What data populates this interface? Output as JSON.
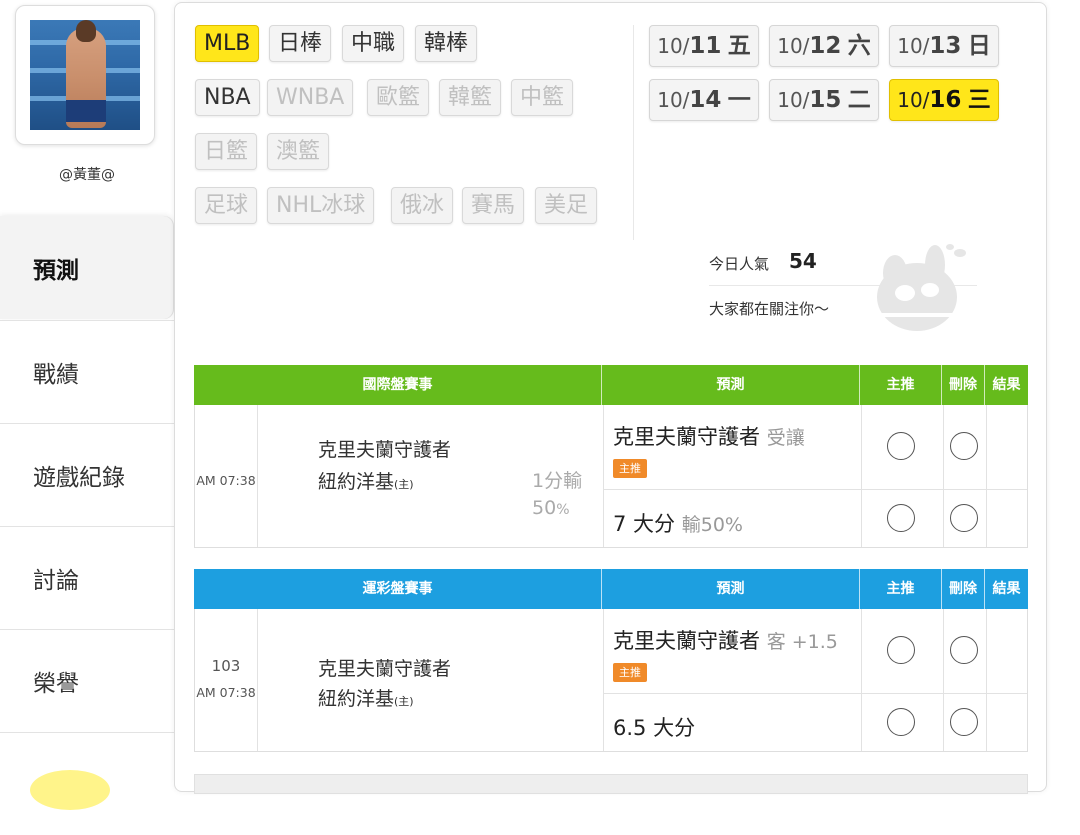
{
  "sidebar": {
    "username": "@黃董@",
    "nav": [
      "預測",
      "戰績",
      "遊戲紀錄",
      "討論",
      "榮譽"
    ]
  },
  "categories": {
    "row1": [
      {
        "label": "MLB",
        "state": "active"
      },
      {
        "label": "日棒",
        "state": "normal"
      },
      {
        "label": "中職",
        "state": "normal"
      },
      {
        "label": "韓棒",
        "state": "normal"
      }
    ],
    "row2": [
      {
        "label": "NBA",
        "state": "normal"
      },
      {
        "label": "WNBA",
        "state": "disabled"
      },
      {
        "label": "歐籃",
        "state": "disabled"
      },
      {
        "label": "韓籃",
        "state": "disabled"
      },
      {
        "label": "中籃",
        "state": "disabled"
      }
    ],
    "row3": [
      {
        "label": "日籃",
        "state": "disabled"
      },
      {
        "label": "澳籃",
        "state": "disabled"
      }
    ],
    "row4": [
      {
        "label": "足球",
        "state": "disabled"
      },
      {
        "label": "NHL冰球",
        "state": "disabled"
      },
      {
        "label": "俄冰",
        "state": "disabled"
      },
      {
        "label": "賽馬",
        "state": "disabled"
      },
      {
        "label": "美足",
        "state": "disabled"
      }
    ]
  },
  "dates": [
    {
      "month": "10/",
      "day": "11",
      "wk": "五",
      "active": false
    },
    {
      "month": "10/",
      "day": "12",
      "wk": "六",
      "active": false
    },
    {
      "month": "10/",
      "day": "13",
      "wk": "日",
      "active": false
    },
    {
      "month": "10/",
      "day": "14",
      "wk": "一",
      "active": false
    },
    {
      "month": "10/",
      "day": "15",
      "wk": "二",
      "active": false
    },
    {
      "month": "10/",
      "day": "16",
      "wk": "三",
      "active": true
    }
  ],
  "popularity": {
    "label": "今日人氣",
    "value": "54",
    "message": "大家都在關注你～"
  },
  "tables": {
    "intl": {
      "headers": {
        "event": "國際盤賽事",
        "predict": "預測",
        "main": "主推",
        "delete": "刪除",
        "result": "結果"
      },
      "time": "AM 07:38",
      "team_away": "克里夫蘭守護者",
      "team_home": "紐約洋基",
      "home_mark": "(主)",
      "line1": "1分輸",
      "line2": "50",
      "line2_unit": "%",
      "pred1_main": "克里夫蘭守護者",
      "pred1_sub": "受讓",
      "tag": "主推",
      "pred2_main": "7 大分",
      "pred2_sub": "輸50%"
    },
    "sport": {
      "headers": {
        "event": "運彩盤賽事",
        "predict": "預測",
        "main": "主推",
        "delete": "刪除",
        "result": "結果"
      },
      "game_no": "103",
      "time": "AM 07:38",
      "team_away": "克里夫蘭守護者",
      "team_home": "紐約洋基",
      "home_mark": "(主)",
      "pred1_main": "克里夫蘭守護者",
      "pred1_sub": "客 +1.5",
      "tag": "主推",
      "pred2_main": "6.5 大分"
    }
  },
  "colors": {
    "green": "#66bb1c",
    "blue": "#1d9fe0",
    "yellow": "#ffe61a",
    "tag": "#f08a29"
  }
}
